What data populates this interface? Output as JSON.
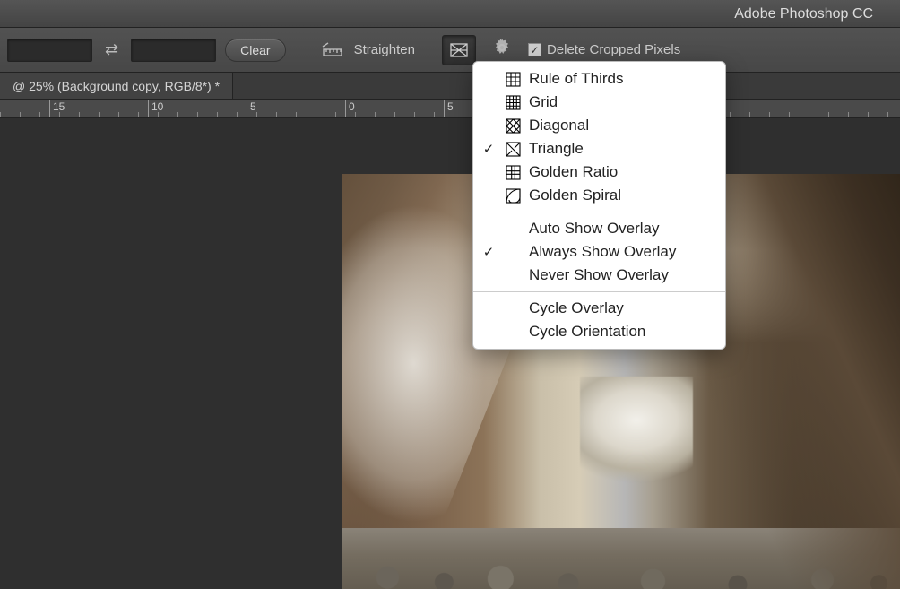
{
  "app": {
    "title": "Adobe Photoshop CC"
  },
  "toolbar": {
    "clear_label": "Clear",
    "straighten_label": "Straighten",
    "delete_cropped_label": "Delete Cropped Pixels",
    "delete_cropped_checked": true
  },
  "document_tab": {
    "label": "@ 25% (Background copy, RGB/8*) *"
  },
  "ruler": {
    "ticks": [
      "15",
      "10",
      "5",
      "0",
      "5"
    ]
  },
  "overlay_menu": {
    "sections": [
      [
        {
          "label": "Rule of Thirds",
          "checked": false,
          "icon": "thirds"
        },
        {
          "label": "Grid",
          "checked": false,
          "icon": "grid"
        },
        {
          "label": "Diagonal",
          "checked": false,
          "icon": "diagonal"
        },
        {
          "label": "Triangle",
          "checked": true,
          "icon": "triangle"
        },
        {
          "label": "Golden Ratio",
          "checked": false,
          "icon": "golden-ratio"
        },
        {
          "label": "Golden Spiral",
          "checked": false,
          "icon": "golden-spiral"
        }
      ],
      [
        {
          "label": "Auto Show Overlay",
          "checked": false
        },
        {
          "label": "Always Show Overlay",
          "checked": true
        },
        {
          "label": "Never Show Overlay",
          "checked": false
        }
      ],
      [
        {
          "label": "Cycle Overlay",
          "checked": false
        },
        {
          "label": "Cycle Orientation",
          "checked": false
        }
      ]
    ]
  }
}
